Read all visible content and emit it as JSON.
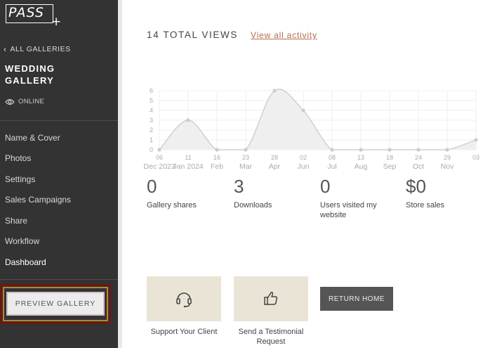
{
  "sidebar": {
    "logo_text": "PASS",
    "logo_plus": "+",
    "back_label": "ALL GALLERIES",
    "gallery_title": "WEDDING GALLERY",
    "status": "ONLINE",
    "nav_items": [
      "Name & Cover",
      "Photos",
      "Settings",
      "Sales Campaigns",
      "Share",
      "Workflow",
      "Dashboard"
    ],
    "active_item": "Dashboard",
    "preview_label": "PREVIEW GALLERY"
  },
  "main": {
    "total_views": "14 TOTAL VIEWS",
    "view_all_link": "View all activity",
    "stats": [
      {
        "value": "0",
        "label": "Gallery shares"
      },
      {
        "value": "3",
        "label": "Downloads"
      },
      {
        "value": "0",
        "label": "Users visited my website"
      },
      {
        "value": "$0",
        "label": "Store sales"
      }
    ],
    "cards": [
      {
        "icon": "headset-icon",
        "label": "Support Your Client"
      },
      {
        "icon": "thumbs-up-icon",
        "label": "Send a Testimonial Request"
      }
    ],
    "return_home": "RETURN HOME"
  },
  "chart_data": {
    "type": "area",
    "x": [
      "06",
      "11",
      "16",
      "23",
      "28",
      "02",
      "08",
      "13",
      "18",
      "24",
      "29",
      "03"
    ],
    "month_labels": [
      {
        "label": "Dec 2023",
        "at": 0
      },
      {
        "label": "Jan 2024",
        "at": 1
      },
      {
        "label": "Feb",
        "at": 2
      },
      {
        "label": "Mar",
        "at": 3
      },
      {
        "label": "Apr",
        "at": 4
      },
      {
        "label": "Jun",
        "at": 5
      },
      {
        "label": "Jul",
        "at": 6
      },
      {
        "label": "Aug",
        "at": 7
      },
      {
        "label": "Sep",
        "at": 8
      },
      {
        "label": "Oct",
        "at": 9
      },
      {
        "label": "Nov",
        "at": 10
      }
    ],
    "series": [
      {
        "values": [
          0,
          3,
          0,
          0,
          6,
          4,
          0,
          0,
          0,
          0,
          0,
          1
        ]
      }
    ],
    "ylim": [
      0,
      6
    ],
    "yticks": [
      0,
      1,
      2,
      3,
      4,
      5,
      6
    ],
    "grid": true,
    "colors": {
      "fill": "#efefef",
      "line": "#d0d0d0",
      "point": "#cccccc",
      "tick": "#aaaaaa"
    }
  }
}
